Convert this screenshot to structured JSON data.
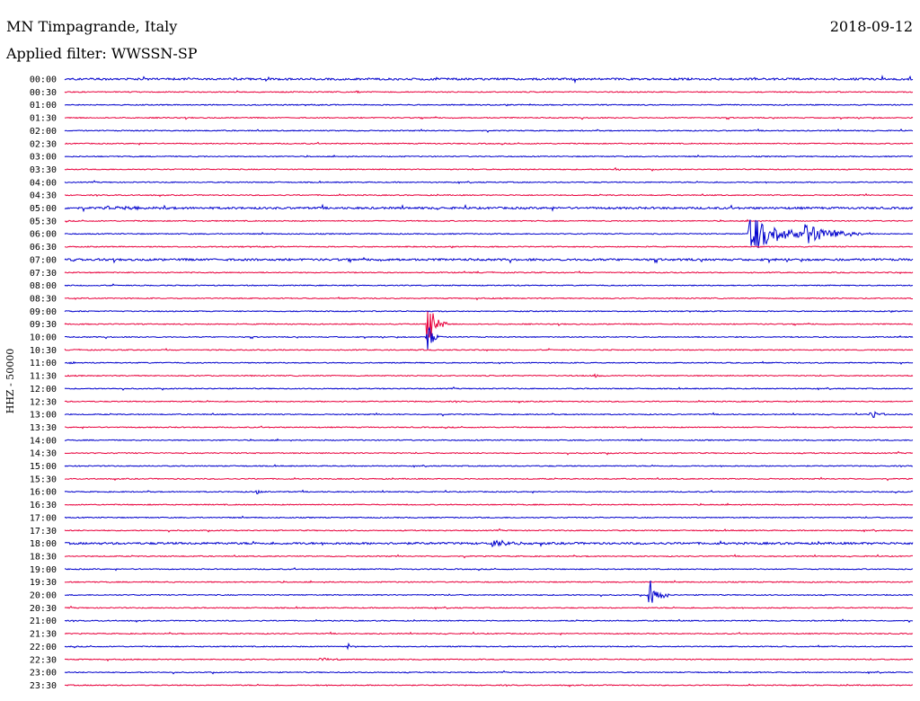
{
  "header": {
    "station": "MN Timpagrande, Italy",
    "date": "2018-09-12",
    "filter": "Applied filter: WWSSN-SP"
  },
  "channel_label": "HHZ - 50000",
  "colors": {
    "trace_even": "#0000cc",
    "trace_odd": "#e8003c",
    "text": "#000000",
    "background": "#ffffff"
  },
  "chart_data": {
    "type": "line",
    "title": "MN Timpagrande, Italy",
    "subtitle": "Applied filter: WWSSN-SP",
    "ylabel": "HHZ - 50000",
    "categories": [
      "00:00",
      "00:30",
      "01:00",
      "01:30",
      "02:00",
      "02:30",
      "03:00",
      "03:30",
      "04:00",
      "04:30",
      "05:00",
      "05:30",
      "06:00",
      "06:30",
      "07:00",
      "07:30",
      "08:00",
      "08:30",
      "09:00",
      "09:30",
      "10:00",
      "10:30",
      "11:00",
      "11:30",
      "12:00",
      "12:30",
      "13:00",
      "13:30",
      "14:00",
      "14:30",
      "15:00",
      "15:30",
      "16:00",
      "16:30",
      "17:00",
      "17:30",
      "18:00",
      "18:30",
      "19:00",
      "19:30",
      "20:00",
      "20:30",
      "21:00",
      "21:30",
      "22:00",
      "22:30",
      "23:00",
      "23:30"
    ],
    "x_unit": "minutes into each 30-minute row",
    "xlim": [
      0,
      30
    ],
    "noise_level": [
      2,
      1,
      1,
      1,
      1,
      1,
      1,
      1,
      1,
      1,
      2,
      1,
      1,
      1,
      2,
      1,
      1,
      1,
      1,
      1,
      1,
      1,
      1,
      1,
      1,
      1,
      1,
      1,
      1,
      1,
      1,
      1,
      1,
      1,
      1,
      1,
      2,
      1,
      1,
      1,
      1,
      1,
      1,
      1,
      1,
      1,
      1,
      1
    ],
    "events": [
      {
        "row": "00:30",
        "minute": 10.3,
        "amplitude": 2,
        "duration": 0.3
      },
      {
        "row": "02:00",
        "minute": 2.8,
        "amplitude": 1,
        "duration": 0.2
      },
      {
        "row": "03:30",
        "minute": 19.4,
        "amplitude": 2,
        "duration": 0.6
      },
      {
        "row": "05:00",
        "minute": 1.5,
        "amplitude": 2,
        "duration": 2.0
      },
      {
        "row": "06:00",
        "minute": 24.2,
        "amplitude": 22,
        "duration": 2.3
      },
      {
        "row": "06:00",
        "minute": 26.1,
        "amplitude": 12,
        "duration": 2.2
      },
      {
        "row": "07:00",
        "minute": 0.2,
        "amplitude": 2,
        "duration": 1.0
      },
      {
        "row": "09:30",
        "minute": 12.8,
        "amplitude": 28,
        "duration": 0.6
      },
      {
        "row": "10:00",
        "minute": 12.8,
        "amplitude": 20,
        "duration": 0.4
      },
      {
        "row": "11:00",
        "minute": 0.2,
        "amplitude": 2,
        "duration": 0.6
      },
      {
        "row": "11:30",
        "minute": 18.7,
        "amplitude": 2,
        "duration": 0.5
      },
      {
        "row": "13:00",
        "minute": 28.5,
        "amplitude": 5,
        "duration": 0.6
      },
      {
        "row": "16:00",
        "minute": 6.8,
        "amplitude": 3,
        "duration": 0.2
      },
      {
        "row": "18:00",
        "minute": 15.1,
        "amplitude": 4,
        "duration": 1.5
      },
      {
        "row": "20:00",
        "minute": 20.6,
        "amplitude": 26,
        "duration": 0.6
      },
      {
        "row": "22:00",
        "minute": 10.0,
        "amplitude": 4,
        "duration": 0.3
      },
      {
        "row": "22:30",
        "minute": 9.0,
        "amplitude": 2,
        "duration": 0.9
      }
    ]
  }
}
